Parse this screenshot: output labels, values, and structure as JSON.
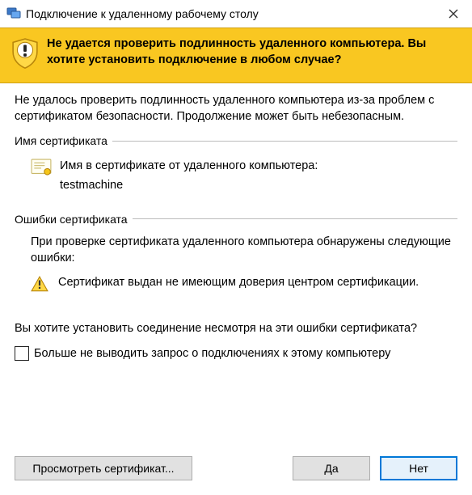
{
  "titlebar": {
    "title": "Подключение к удаленному рабочему столу"
  },
  "banner": {
    "text": "Не удается проверить подлинность удаленного компьютера. Вы хотите установить подключение в любом случае?"
  },
  "intro": "Не удалось проверить подлинность удаленного компьютера из-за проблем с сертификатом безопасности. Продолжение может быть небезопасным.",
  "cert_group": {
    "legend": "Имя сертификата",
    "label": "Имя в сертификате от удаленного компьютера:",
    "value": "testmachine"
  },
  "errors_group": {
    "legend": "Ошибки сертификата",
    "intro": "При проверке сертификата удаленного компьютера обнаружены следующие ошибки:",
    "items": [
      "Сертификат выдан не имеющим доверия центром сертификации."
    ]
  },
  "confirm_text": "Вы хотите установить соединение несмотря на эти ошибки сертификата?",
  "checkbox_label": "Больше не выводить запрос о подключениях к этому компьютеру",
  "buttons": {
    "view_cert": "Просмотреть сертификат...",
    "yes": "Да",
    "no": "Нет"
  }
}
